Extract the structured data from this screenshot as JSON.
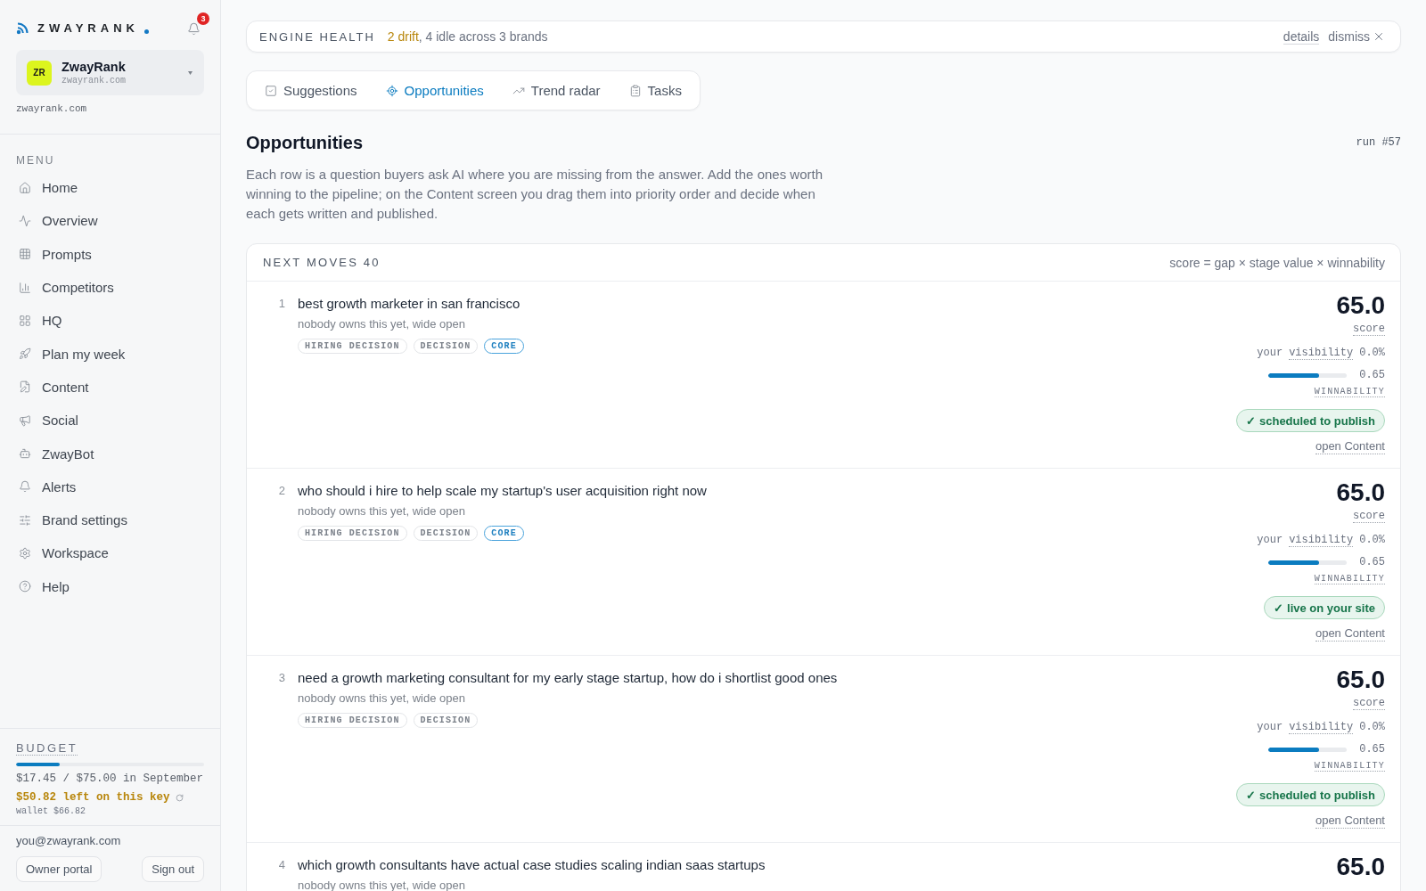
{
  "sidebar": {
    "logo": {
      "wordmark": "ZWAYRANK"
    },
    "notifications": {
      "count": "3"
    },
    "brand": {
      "initials": "ZR",
      "name": "ZwayRank",
      "domain": "zwayrank.com"
    },
    "domain_label": "zwayrank.com",
    "menu_title": "MENU",
    "items": [
      {
        "label": "Home",
        "selected": false
      },
      {
        "label": "Overview",
        "selected": false
      },
      {
        "label": "Prompts",
        "selected": false
      },
      {
        "label": "Competitors",
        "selected": false
      },
      {
        "label": "HQ",
        "selected": false
      },
      {
        "label": "Plan my week",
        "selected": false
      },
      {
        "label": "Content",
        "selected": false
      },
      {
        "label": "Social",
        "selected": false
      },
      {
        "label": "ZwayBot",
        "selected": false
      },
      {
        "label": "Alerts",
        "selected": false
      },
      {
        "label": "Brand settings",
        "selected": false
      },
      {
        "label": "Workspace",
        "selected": false
      },
      {
        "label": "Help",
        "selected": false
      }
    ],
    "budget": {
      "title": "BUDGET",
      "level": 0.23,
      "spent": "$17.45 / $75.00 in September",
      "remaining": "$50.82 left on this key",
      "wallet": "wallet $66.82"
    },
    "account": {
      "email": "you@zwayrank.com",
      "buttons": [
        "Owner portal",
        "Sign out"
      ]
    }
  },
  "engine_health": {
    "title": "ENGINE HEALTH",
    "summary": {
      "highlight": "2 drift",
      "rest": ", 4 idle across 3 brands"
    },
    "details": "details",
    "dismiss": "dismiss"
  },
  "tabs": [
    {
      "label": "Suggestions",
      "selected": false
    },
    {
      "label": "Opportunities",
      "selected": true
    },
    {
      "label": "Trend radar",
      "selected": false
    },
    {
      "label": "Tasks",
      "selected": false
    }
  ],
  "page": {
    "title": "Opportunities",
    "run": "run #57",
    "description": "Each row is a question buyers ask AI where you are missing from the answer. Add the ones worth winning to the pipeline; on the Content screen you drag them into priority order and decide when each gets written and published."
  },
  "next_moves": {
    "title": "NEXT MOVES 40",
    "formula": "score = gap × stage value × winnability",
    "rows": [
      {
        "rank": "1",
        "question": "best growth marketer in san francisco",
        "note": "nobody owns this yet, wide open",
        "tags": [
          {
            "label": "HIRING DECISION",
            "kind": "stage"
          },
          {
            "label": "DECISION",
            "kind": "stage"
          },
          {
            "label": "CORE",
            "kind": "core"
          }
        ],
        "score": "65.0",
        "score_label": "score",
        "visibility": {
          "label": "your",
          "term": "visibility",
          "value": "0.0%"
        },
        "winnability": {
          "level": 0.65,
          "value": "0.65",
          "label": "WINNABILITY"
        },
        "status": "✓ scheduled to publish",
        "link": "open Content"
      },
      {
        "rank": "2",
        "question": "who should i hire to help scale my startup's user acquisition right now",
        "note": "nobody owns this yet, wide open",
        "tags": [
          {
            "label": "HIRING DECISION",
            "kind": "stage"
          },
          {
            "label": "DECISION",
            "kind": "stage"
          },
          {
            "label": "CORE",
            "kind": "core"
          }
        ],
        "score": "65.0",
        "score_label": "score",
        "visibility": {
          "label": "your",
          "term": "visibility",
          "value": "0.0%"
        },
        "winnability": {
          "level": 0.65,
          "value": "0.65",
          "label": "WINNABILITY"
        },
        "status": "✓ live on your site",
        "link": "open Content"
      },
      {
        "rank": "3",
        "question": "need a growth marketing consultant for my early stage startup, how do i shortlist good ones",
        "note": "nobody owns this yet, wide open",
        "tags": [
          {
            "label": "HIRING DECISION",
            "kind": "stage"
          },
          {
            "label": "DECISION",
            "kind": "stage"
          }
        ],
        "score": "65.0",
        "score_label": "score",
        "visibility": {
          "label": "your",
          "term": "visibility",
          "value": "0.0%"
        },
        "winnability": {
          "level": 0.65,
          "value": "0.65",
          "label": "WINNABILITY"
        },
        "status": "✓ scheduled to publish",
        "link": "open Content"
      },
      {
        "rank": "4",
        "question": "which growth consultants have actual case studies scaling indian saas startups",
        "note": "nobody owns this yet, wide open",
        "score": "65.0"
      }
    ]
  }
}
